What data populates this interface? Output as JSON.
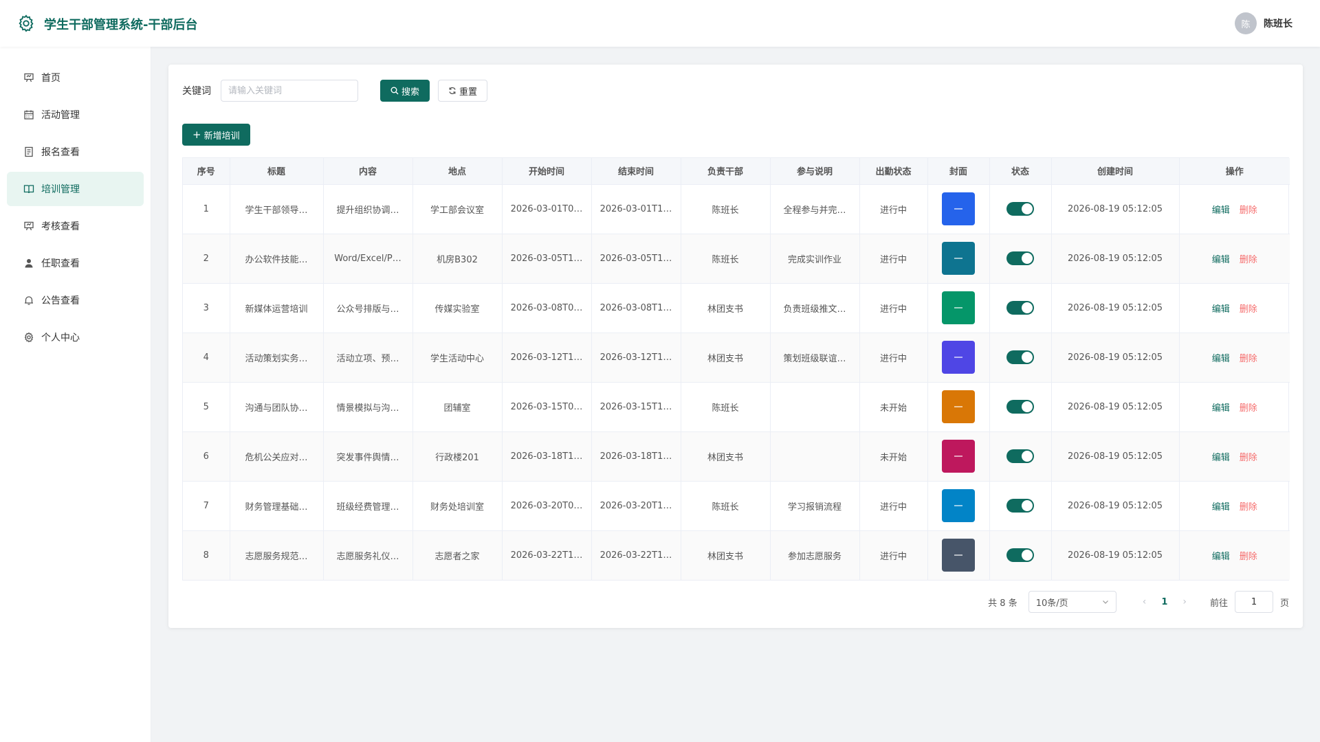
{
  "app": {
    "title": "学生干部管理系统-干部后台"
  },
  "user": {
    "avatar_text": "陈",
    "name": "陈班长"
  },
  "sidebar": {
    "items": [
      {
        "label": "首页",
        "icon": "presentation-icon",
        "active": false
      },
      {
        "label": "活动管理",
        "icon": "calendar-icon",
        "active": false
      },
      {
        "label": "报名查看",
        "icon": "document-icon",
        "active": false
      },
      {
        "label": "培训管理",
        "icon": "book-icon",
        "active": true
      },
      {
        "label": "考核查看",
        "icon": "presentation-icon",
        "active": false
      },
      {
        "label": "任职查看",
        "icon": "user-icon",
        "active": false
      },
      {
        "label": "公告查看",
        "icon": "bell-icon",
        "active": false
      },
      {
        "label": "个人中心",
        "icon": "gear-icon",
        "active": false
      }
    ]
  },
  "search": {
    "label": "关键词",
    "placeholder": "请输入关键词",
    "value": "",
    "search_label": "搜索",
    "reset_label": "重置"
  },
  "toolbar": {
    "add_label": "新增培训"
  },
  "table": {
    "columns": [
      "序号",
      "标题",
      "内容",
      "地点",
      "开始时间",
      "结束时间",
      "负责干部",
      "参与说明",
      "出勤状态",
      "封面",
      "状态",
      "创建时间",
      "操作"
    ],
    "edit_label": "编辑",
    "delete_label": "删除",
    "rows": [
      {
        "no": "1",
        "title": "学生干部领导…",
        "content": "提升组织协调…",
        "place": "学工部会议室",
        "start": "2026-03-01T0…",
        "end": "2026-03-01T1…",
        "leader": "陈班长",
        "note": "全程参与并完…",
        "attendance": "进行中",
        "cover_color": "#2563eb",
        "enabled": true,
        "created": "2026-08-19 05:12:05"
      },
      {
        "no": "2",
        "title": "办公软件技能…",
        "content": "Word/Excel/P…",
        "place": "机房B302",
        "start": "2026-03-05T1…",
        "end": "2026-03-05T1…",
        "leader": "陈班长",
        "note": "完成实训作业",
        "attendance": "进行中",
        "cover_color": "#0e7490",
        "enabled": true,
        "created": "2026-08-19 05:12:05"
      },
      {
        "no": "3",
        "title": "新媒体运营培训",
        "content": "公众号排版与…",
        "place": "传媒实验室",
        "start": "2026-03-08T0…",
        "end": "2026-03-08T1…",
        "leader": "林团支书",
        "note": "负责班级推文…",
        "attendance": "进行中",
        "cover_color": "#059669",
        "enabled": true,
        "created": "2026-08-19 05:12:05"
      },
      {
        "no": "4",
        "title": "活动策划实务…",
        "content": "活动立项、预…",
        "place": "学生活动中心",
        "start": "2026-03-12T1…",
        "end": "2026-03-12T1…",
        "leader": "林团支书",
        "note": "策划班级联谊…",
        "attendance": "进行中",
        "cover_color": "#4f46e5",
        "enabled": true,
        "created": "2026-08-19 05:12:05"
      },
      {
        "no": "5",
        "title": "沟通与团队协…",
        "content": "情景模拟与沟…",
        "place": "团辅室",
        "start": "2026-03-15T0…",
        "end": "2026-03-15T1…",
        "leader": "陈班长",
        "note": "",
        "attendance": "未开始",
        "cover_color": "#d97706",
        "enabled": true,
        "created": "2026-08-19 05:12:05"
      },
      {
        "no": "6",
        "title": "危机公关应对…",
        "content": "突发事件舆情…",
        "place": "行政楼201",
        "start": "2026-03-18T1…",
        "end": "2026-03-18T1…",
        "leader": "林团支书",
        "note": "",
        "attendance": "未开始",
        "cover_color": "#be185d",
        "enabled": true,
        "created": "2026-08-19 05:12:05"
      },
      {
        "no": "7",
        "title": "财务管理基础…",
        "content": "班级经费管理…",
        "place": "财务处培训室",
        "start": "2026-03-20T0…",
        "end": "2026-03-20T1…",
        "leader": "陈班长",
        "note": "学习报销流程",
        "attendance": "进行中",
        "cover_color": "#0284c7",
        "enabled": true,
        "created": "2026-08-19 05:12:05"
      },
      {
        "no": "8",
        "title": "志愿服务规范…",
        "content": "志愿服务礼仪…",
        "place": "志愿者之家",
        "start": "2026-03-22T1…",
        "end": "2026-03-22T1…",
        "leader": "林团支书",
        "note": "参加志愿服务",
        "attendance": "进行中",
        "cover_color": "#475569",
        "enabled": true,
        "created": "2026-08-19 05:12:05"
      }
    ]
  },
  "pagination": {
    "total_text": "共 8 条",
    "page_size": "10条/页",
    "current_page": "1",
    "goto_label": "前往",
    "goto_value": "1",
    "goto_unit": "页"
  },
  "colors": {
    "primary": "#0f6b5f",
    "danger": "#f56c6c",
    "active_bg": "#e8f5f1"
  }
}
